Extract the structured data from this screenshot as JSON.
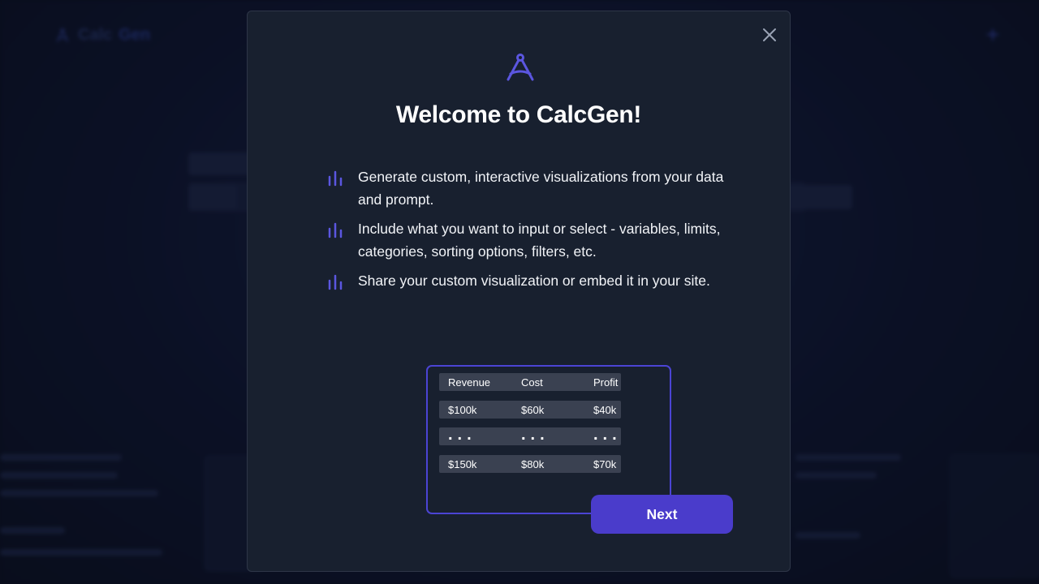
{
  "background": {
    "logo_calc": "Calc",
    "logo_gen": "Gen"
  },
  "modal": {
    "title": "Welcome to CalcGen!",
    "features": [
      "Generate custom, interactive visualizations from your data and prompt.",
      "Include what you want to input or select - variables, limits, categories, sorting options, filters, etc.",
      "Share your custom visualization or embed it in your site."
    ],
    "table": {
      "headers": [
        "Revenue",
        "Cost",
        "Profit"
      ],
      "rows": [
        [
          "$100k",
          "$60k",
          "$40k"
        ],
        [
          "...",
          "...",
          "..."
        ],
        [
          "$150k",
          "$80k",
          "$70k"
        ]
      ]
    },
    "next_label": "Next"
  },
  "colors": {
    "accent": "#4a3ccb",
    "icon": "#5b56e0",
    "modal_bg": "#18202f"
  }
}
